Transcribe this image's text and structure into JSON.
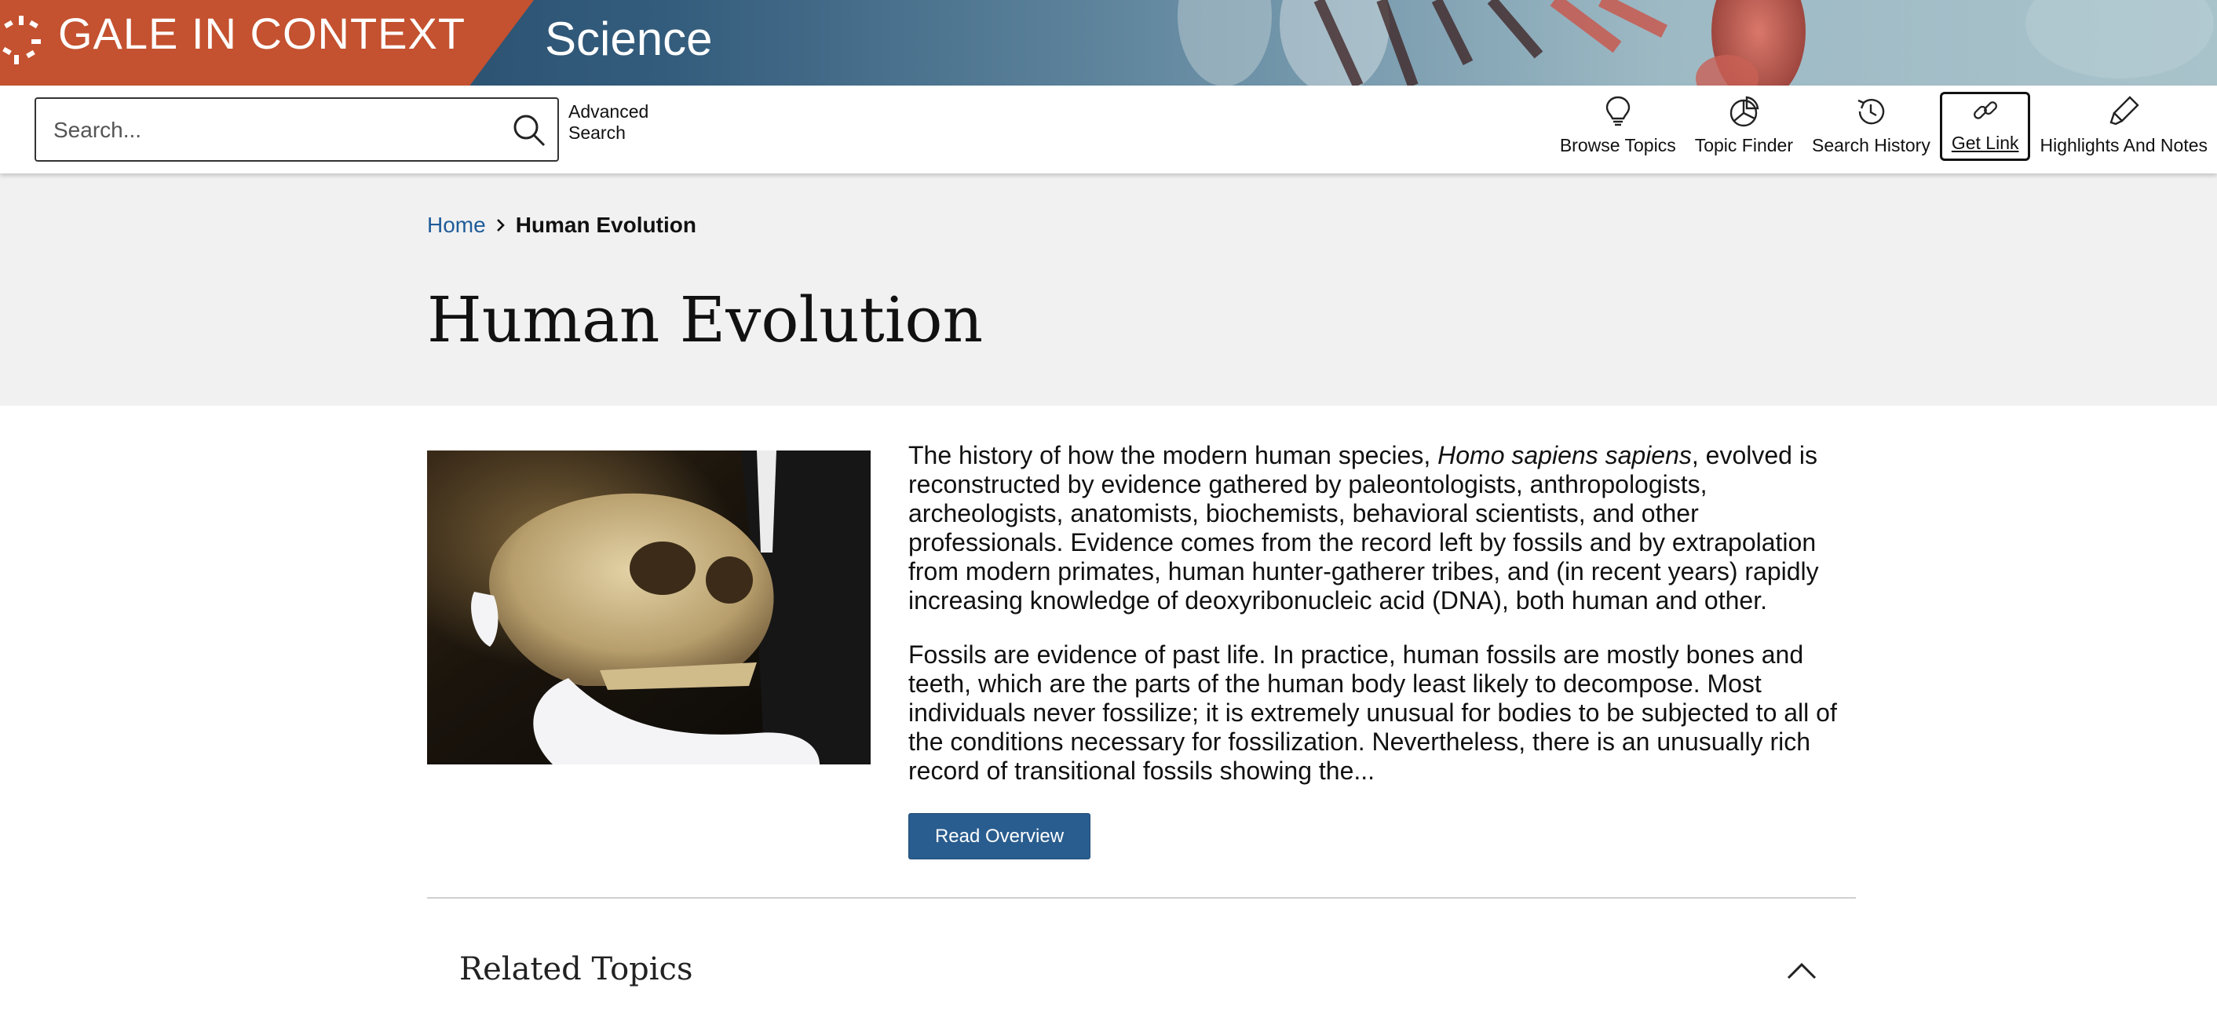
{
  "banner": {
    "brand": "GALE IN CONTEXT",
    "product": "Science"
  },
  "search": {
    "placeholder": "Search...",
    "advanced_label": "Advanced Search"
  },
  "tools": [
    {
      "label": "Browse Topics",
      "icon": "lightbulb-icon"
    },
    {
      "label": "Topic Finder",
      "icon": "pie-chart-icon"
    },
    {
      "label": "Search History",
      "icon": "history-icon"
    },
    {
      "label": "Get Link",
      "icon": "link-icon",
      "active": true
    },
    {
      "label": "Highlights And Notes",
      "icon": "highlighter-icon"
    }
  ],
  "breadcrumb": {
    "home": "Home",
    "current": "Human Evolution"
  },
  "page_title": "Human Evolution",
  "overview": {
    "p1_before": "The history of how the modern human species, ",
    "p1_italic": "Homo sapiens sapiens",
    "p1_after": ", evolved is reconstructed by evidence gathered by paleontologists, anthropologists, archeologists, anatomists, biochemists, behavioral scientists, and other professionals. Evidence comes from the record left by fossils and by extrapolation from modern primates, human hunter-gatherer tribes, and (in recent years) rapidly increasing knowledge of deoxyribonucleic acid (DNA), both human and other.",
    "p2": "Fossils are evidence of past life. In practice, human fossils are mostly bones and teeth, which are the parts of the human body least likely to decompose. Most individuals never fossilize; it is extremely unusual for bodies to be subjected to all of the conditions necessary for fossilization. Nevertheless, there is an unusually rich record of transitional fossils showing the...",
    "button": "Read Overview"
  },
  "related": {
    "title": "Related Topics",
    "expanded": true
  },
  "colors": {
    "brand": "#c4512f",
    "link": "#1f5b9a",
    "button": "#2a5d8f",
    "hero_bg": "#f1f1f1"
  }
}
